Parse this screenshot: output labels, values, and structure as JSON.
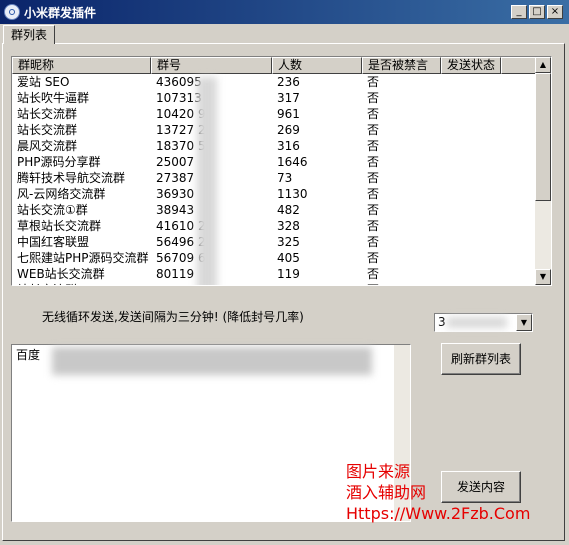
{
  "window": {
    "title": "小米群发插件",
    "minimize_glyph": "_",
    "maximize_glyph": "□",
    "close_glyph": "×"
  },
  "tabs": [
    {
      "label": "群列表",
      "active": true
    }
  ],
  "group_list": {
    "columns": [
      "群昵称",
      "群号",
      "人数",
      "是否被禁言",
      "发送状态"
    ],
    "rows": [
      {
        "name": "爱站 SEO",
        "number": "436095",
        "members": "236",
        "muted": "否",
        "status": ""
      },
      {
        "name": "站长吹牛逼群",
        "number": "107313",
        "members": "317",
        "muted": "否",
        "status": ""
      },
      {
        "name": "站长交流群",
        "number": "10420  9",
        "members": "961",
        "muted": "否",
        "status": ""
      },
      {
        "name": "站长交流群",
        "number": "13727  2",
        "members": "269",
        "muted": "否",
        "status": ""
      },
      {
        "name": "晨风交流群",
        "number": "18370  5",
        "members": "316",
        "muted": "否",
        "status": ""
      },
      {
        "name": "PHP源码分享群",
        "number": "25007",
        "members": "1646",
        "muted": "否",
        "status": ""
      },
      {
        "name": "腾轩技术导航交流群",
        "number": "27387",
        "members": "73",
        "muted": "否",
        "status": ""
      },
      {
        "name": "风-云网络交流群",
        "number": "36930",
        "members": "1130",
        "muted": "否",
        "status": ""
      },
      {
        "name": "站长交流①群",
        "number": "38943",
        "members": "482",
        "muted": "否",
        "status": ""
      },
      {
        "name": "草根站长交流群",
        "number": "41610  2",
        "members": "328",
        "muted": "否",
        "status": ""
      },
      {
        "name": "中国红客联盟",
        "number": "56496  2",
        "members": "325",
        "muted": "否",
        "status": ""
      },
      {
        "name": "七熙建站PHP源码交流群",
        "number": "56709  6",
        "members": "405",
        "muted": "否",
        "status": ""
      },
      {
        "name": "WEB站长交流群",
        "number": "80119",
        "members": "119",
        "muted": "否",
        "status": ""
      },
      {
        "name": "站长交流群",
        "number": "",
        "members": "",
        "muted": "否",
        "status": ""
      }
    ],
    "scroll_up_glyph": "▲",
    "scroll_down_glyph": "▼"
  },
  "note_text": "无线循环发送,发送间隔为三分钟! (降低封号几率)",
  "interval_select": {
    "value": "3",
    "arrow_glyph": "▼"
  },
  "message_box": {
    "text": "百度"
  },
  "buttons": {
    "refresh": "刷新群列表",
    "send": "发送内容"
  },
  "watermark": {
    "line1": "图片来源",
    "line2": "酒入辅助网",
    "line3": "Https://Www.2Fzb.Com"
  },
  "colors": {
    "title_bar": "#0a246a",
    "watermark": "#e60000",
    "window_bg": "#d4d0c8"
  }
}
